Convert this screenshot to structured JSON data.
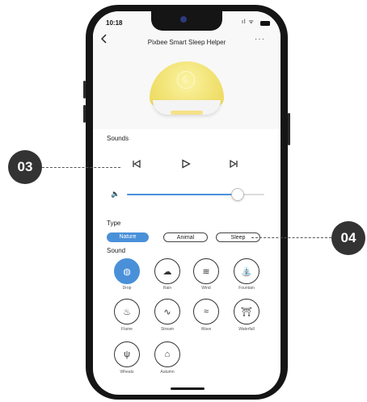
{
  "status_bar": {
    "time": "10:18",
    "icons": "..ıl ᯤ"
  },
  "header": {
    "back_icon": "chevron-left-icon",
    "title": "Pixbee Smart Sleep Helper",
    "more": "···"
  },
  "sounds_section": {
    "title": "Sounds",
    "controls": {
      "previous": "⏮",
      "play": "▷",
      "next": "⏭"
    },
    "volume_level": 0.8
  },
  "type_section": {
    "title": "Type",
    "tabs": [
      {
        "label": "Nature",
        "active": true
      },
      {
        "label": "Animal",
        "active": false
      },
      {
        "label": "Sleep",
        "active": false
      }
    ]
  },
  "sound_section": {
    "title": "Sound",
    "items": [
      {
        "label": "Drop",
        "icon": "water-drop-icon",
        "glyph": "◍",
        "active": true
      },
      {
        "label": "Rain",
        "icon": "rain-cloud-icon",
        "glyph": "☁",
        "active": false
      },
      {
        "label": "Wind",
        "icon": "wind-icon",
        "glyph": "≋",
        "active": false
      },
      {
        "label": "Fountain",
        "icon": "fountain-icon",
        "glyph": "⛲",
        "active": false
      },
      {
        "label": "Flame",
        "icon": "flame-icon",
        "glyph": "♨",
        "active": false
      },
      {
        "label": "Stream",
        "icon": "stream-icon",
        "glyph": "∿",
        "active": false
      },
      {
        "label": "Wave",
        "icon": "wave-icon",
        "glyph": "≈",
        "active": false
      },
      {
        "label": "Waterfall",
        "icon": "waterfall-icon",
        "glyph": "⛩",
        "active": false
      },
      {
        "label": "Wheats",
        "icon": "wheat-icon",
        "glyph": "ψ",
        "active": false
      },
      {
        "label": "Autumn",
        "icon": "autumn-tree-icon",
        "glyph": "⌂",
        "active": false
      }
    ]
  },
  "callouts": [
    {
      "label": "03"
    },
    {
      "label": "04"
    }
  ],
  "colors": {
    "accent": "#4a90d9",
    "lamp": "#f2e478",
    "callout": "#333333"
  }
}
